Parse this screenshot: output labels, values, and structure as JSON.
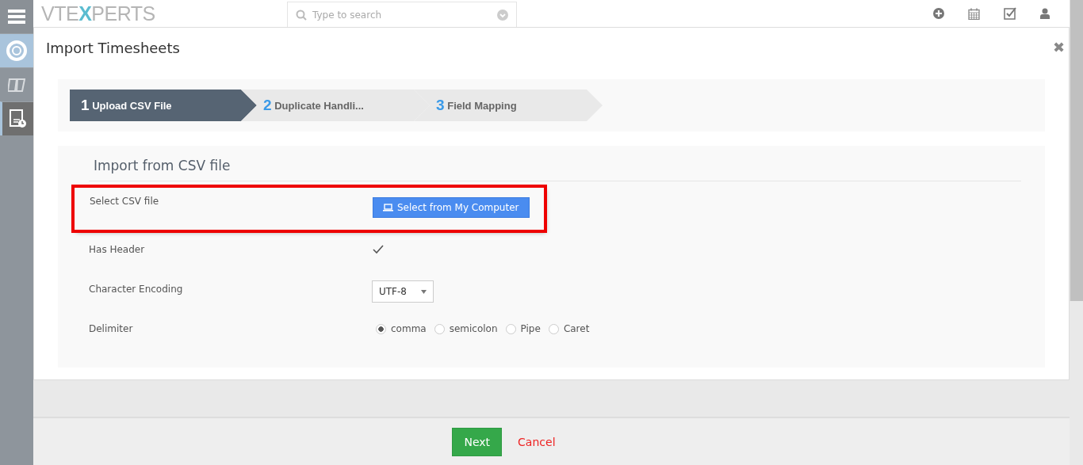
{
  "logo": {
    "before": "VTE",
    "accent": "X",
    "after": "PERTS"
  },
  "search": {
    "placeholder": "Type to search"
  },
  "sidebar": {
    "items": [
      {
        "kind": "support",
        "selected": false
      },
      {
        "kind": "tickets",
        "selected": false
      },
      {
        "kind": "timesheet",
        "selected": true
      }
    ]
  },
  "modal": {
    "title": "Import Timesheets",
    "close": "✖"
  },
  "steps": [
    {
      "number": "1",
      "label": "Upload CSV File",
      "selected": true
    },
    {
      "number": "2",
      "label": "Duplicate Handli...",
      "selected": false
    },
    {
      "number": "3",
      "label": "Field Mapping",
      "selected": false
    }
  ],
  "form": {
    "heading": "Import from CSV file",
    "file": {
      "label": "Select CSV file",
      "button": "Select from My Computer"
    },
    "header": {
      "label": "Has Header",
      "checked": true
    },
    "encoding": {
      "label": "Character Encoding",
      "value": "UTF-8"
    },
    "delimiter": {
      "label": "Delimiter",
      "options": [
        {
          "label": "comma",
          "selected": true
        },
        {
          "label": "semicolon",
          "selected": false
        },
        {
          "label": "Pipe",
          "selected": false
        },
        {
          "label": "Caret",
          "selected": false
        }
      ]
    }
  },
  "footer": {
    "next": "Next",
    "cancel": "Cancel"
  }
}
